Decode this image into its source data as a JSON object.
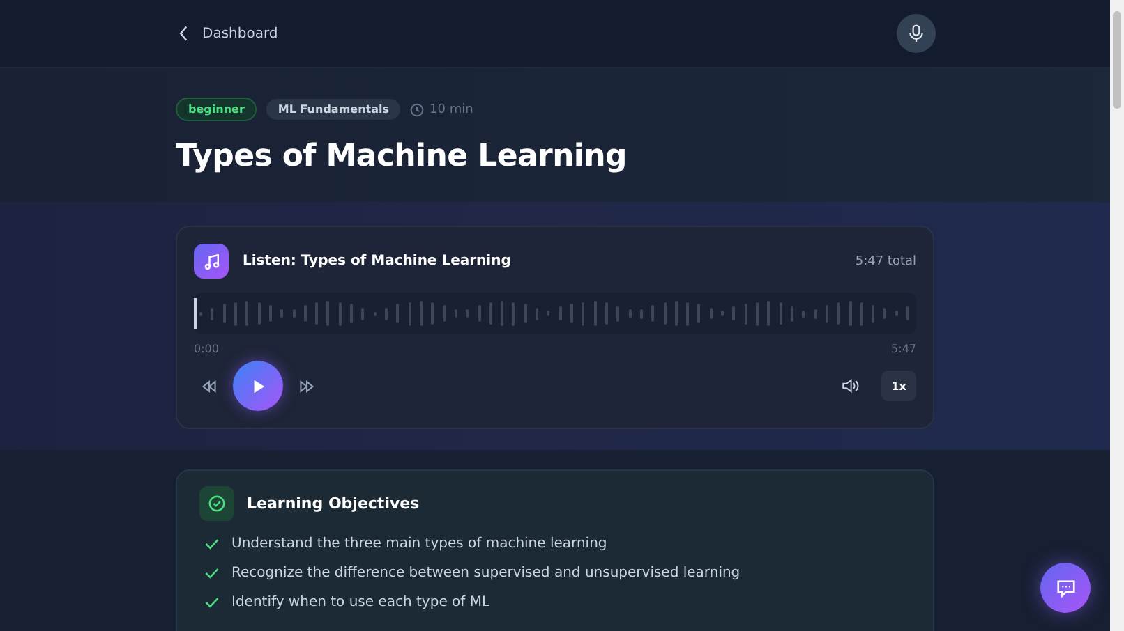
{
  "nav": {
    "back_label": "Dashboard"
  },
  "lesson": {
    "tags": [
      {
        "label": "beginner",
        "kind": "level"
      },
      {
        "label": "ML Fundamentals",
        "kind": "topic"
      }
    ],
    "duration": "10 min",
    "title": "Types of Machine Learning"
  },
  "audio_player": {
    "title": "Listen: Types of Machine Learning",
    "total": "5:47 total",
    "level": 0,
    "current_time": "0:00",
    "end_time": "5:47",
    "speed": "1x",
    "playing": false
  },
  "objectives": {
    "title": "Learning Objectives",
    "items": [
      "Understand the three main types of machine learning",
      "Recognize the difference between supervised and unsupervised learning",
      "Identify when to use each type of ML"
    ]
  }
}
